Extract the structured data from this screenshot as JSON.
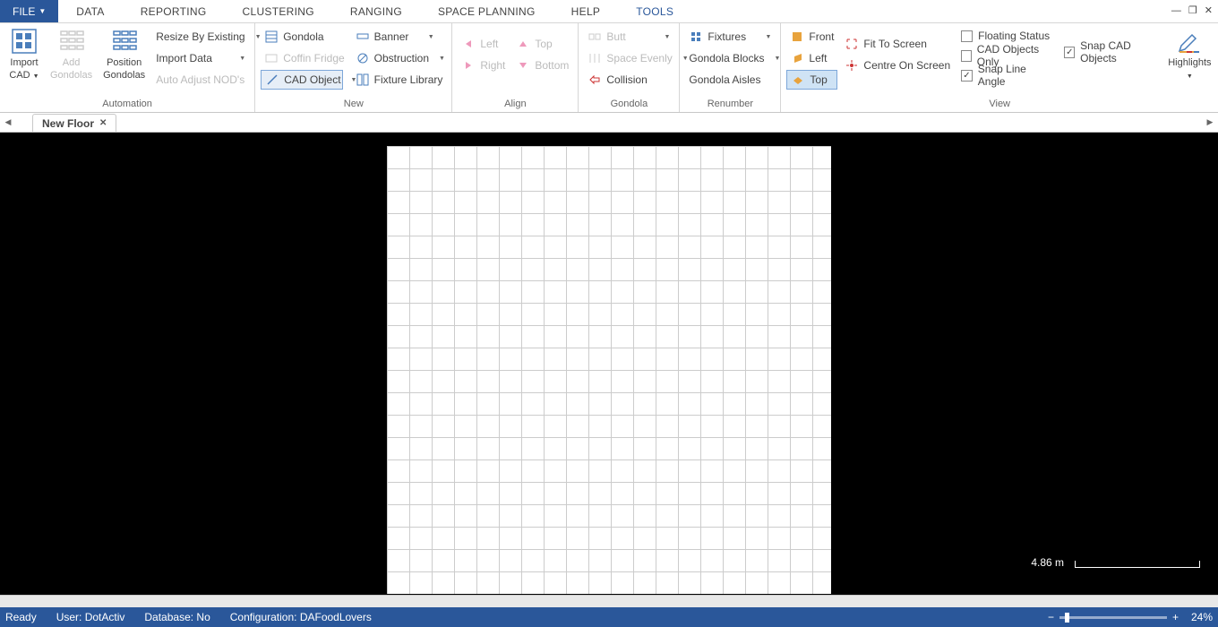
{
  "tabs": {
    "file": "FILE",
    "data": "DATA",
    "reporting": "REPORTING",
    "clustering": "CLUSTERING",
    "ranging": "RANGING",
    "space_planning": "SPACE PLANNING",
    "help": "HELP",
    "tools": "TOOLS"
  },
  "groups": {
    "automation": {
      "label": "Automation",
      "import_cad": "Import\nCAD",
      "add_gondolas": "Add\nGondolas",
      "position_gondolas": "Position\nGondolas",
      "resize_existing": "Resize By Existing",
      "import_data": "Import Data",
      "auto_adjust": "Auto Adjust NOD's"
    },
    "new": {
      "label": "New",
      "gondola": "Gondola",
      "coffin_fridge": "Coffin Fridge",
      "cad_object": "CAD Object",
      "banner": "Banner",
      "obstruction": "Obstruction",
      "fixture_library": "Fixture Library"
    },
    "align": {
      "label": "Align",
      "left": "Left",
      "right": "Right",
      "top": "Top",
      "bottom": "Bottom"
    },
    "gondola": {
      "label": "Gondola",
      "butt": "Butt",
      "space_evenly": "Space Evenly",
      "collision": "Collision"
    },
    "renumber": {
      "label": "Renumber",
      "fixtures": "Fixtures",
      "gondola_blocks": "Gondola Blocks",
      "gondola_aisles": "Gondola Aisles"
    },
    "view": {
      "label": "View",
      "front": "Front",
      "left": "Left",
      "top": "Top",
      "fit": "Fit To Screen",
      "centre": "Centre On Screen",
      "floating_status": "Floating Status",
      "cad_objects_only": "CAD Objects Only",
      "snap_line_angle": "Snap Line Angle",
      "snap_cad_objects": "Snap CAD Objects",
      "highlights": "Highlights"
    }
  },
  "doc_tab": "New Floor",
  "scale": "4.86 m",
  "status": {
    "ready": "Ready",
    "user": "User: DotActiv",
    "database": "Database: No",
    "config": "Configuration: DAFoodLovers",
    "zoom": "24%"
  }
}
